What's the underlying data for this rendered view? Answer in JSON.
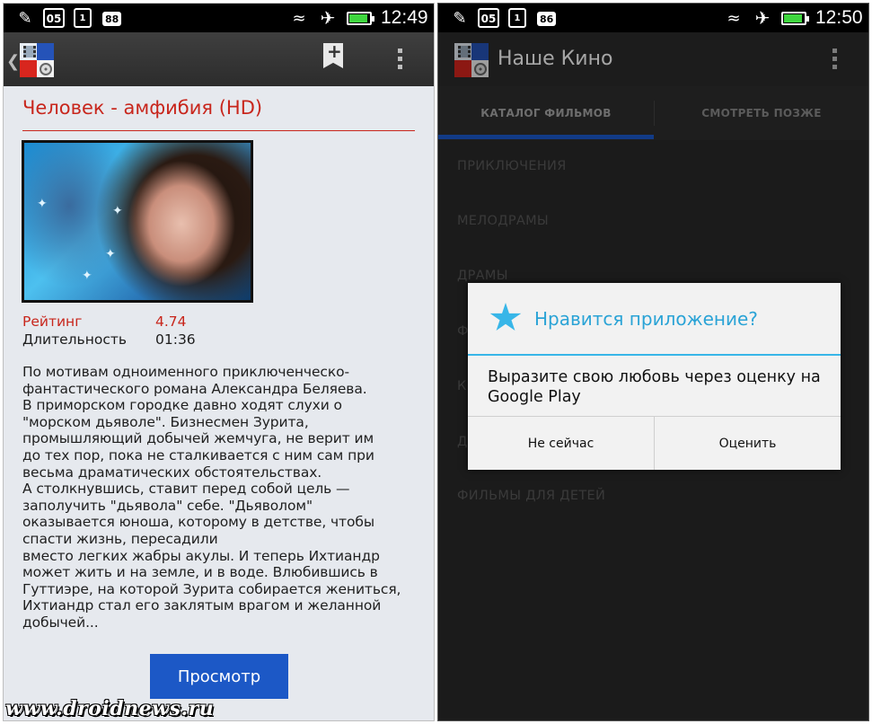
{
  "left": {
    "status": {
      "date": "05",
      "cal": "1",
      "badge": "88",
      "time": "12:49"
    },
    "movie": {
      "title": "Человек - амфибия (HD)",
      "rating_label": "Рейтинг",
      "rating_value": "4.74",
      "duration_label": "Длительность",
      "duration_value": "01:36",
      "description": "По мотивам одноименного приключенческо-\nфантастического романа Александра Беляева.\nВ приморском городке давно ходят слухи о\n\"морском дьяволе\". Бизнесмен Зурита,\nпромышляющий добычей жемчуга, не верит им\nдо тех пор, пока не сталкивается с ним сам при\nвесьма драматических обстоятельствах.\nА столкнувшись, ставит перед собой цель —\nзаполучить \"дьявола\" себе. \"Дьяволом\"\nоказывается юноша, которому в детстве, чтобы\nспасти жизнь, пересадили\nвместо легких жабры акулы. И теперь Ихтиандр\nможет жить и на земле, и в воде. Влюбившись в\nГуттиэре, на которой Зурита собирается жениться,\nИхтиандр стал его заклятым врагом и желанной\nдобычей..."
    },
    "watch_label": "Просмотр",
    "watermark": "www.droidnews.ru"
  },
  "right": {
    "status": {
      "date": "05",
      "cal": "1",
      "badge": "86",
      "time": "12:50"
    },
    "app_title": "Наше Кино",
    "tabs": [
      "КАТАЛОГ ФИЛЬМОВ",
      "СМОТРЕТЬ ПОЗЖЕ"
    ],
    "categories": [
      "ПРИКЛЮЧЕНИЯ",
      "МЕЛОДРАМЫ",
      "ДРАМЫ",
      "Ф",
      "К",
      "Д",
      "ФИЛЬМЫ ДЛЯ ДЕТЕЙ"
    ],
    "dialog": {
      "title": "Нравится приложение?",
      "message": "Выразите свою любовь через оценку на Google Play",
      "btn_not_now": "Не сейчас",
      "btn_rate": "Оценить"
    }
  },
  "colors": {
    "accent_red": "#c8261c",
    "button_blue": "#1c58c6",
    "dialog_accent": "#38b6e8",
    "tab_indicator": "#1d5bd0"
  }
}
